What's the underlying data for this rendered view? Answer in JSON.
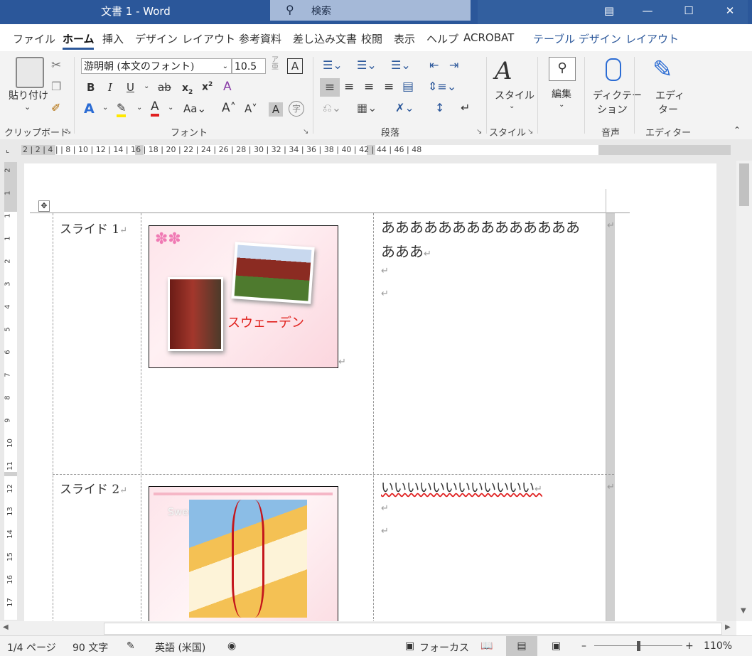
{
  "titlebar": {
    "title": "文書 1  -  Word",
    "search_placeholder": "検索"
  },
  "tabs": [
    {
      "label": "ファイル"
    },
    {
      "label": "ホーム"
    },
    {
      "label": "挿入"
    },
    {
      "label": "デザイン"
    },
    {
      "label": "レイアウト"
    },
    {
      "label": "参考資料"
    },
    {
      "label": "差し込み文書"
    },
    {
      "label": "校閲"
    },
    {
      "label": "表示"
    },
    {
      "label": "ヘルプ"
    },
    {
      "label": "ACROBAT"
    },
    {
      "label": "テーブル デザイン"
    },
    {
      "label": "レイアウト"
    }
  ],
  "ribbon": {
    "clipboard": {
      "paste": "貼り付け",
      "group": "クリップボード"
    },
    "font": {
      "name": "游明朝 (本文のフォント)",
      "size": "10.5",
      "group": "フォント"
    },
    "paragraph": {
      "group": "段落"
    },
    "style": {
      "button": "スタイル",
      "group": "スタイル"
    },
    "edit": {
      "button": "編集"
    },
    "voice": {
      "button_line1": "ディクテー",
      "button_line2": "ション",
      "group": "音声"
    },
    "editor": {
      "button_line1": "エディ",
      "button_line2": "ター",
      "group": "エディター"
    }
  },
  "ruler": {
    "ticks": "2 | 2 | 4 | | 8 | 10 | 12 | 14 | 16 | 18 | 20 | 22 | 24 | 26 | 28 | 30 | 32 | 34 | 36 | 38 | 40 | 42 | 44 | 46 | 48"
  },
  "vruler": {
    "numbers": [
      "2",
      "1",
      "1",
      "1",
      "2",
      "3",
      "4",
      "5",
      "6",
      "7",
      "8",
      "9",
      "10",
      "11",
      "12",
      "13",
      "14",
      "15",
      "16",
      "17"
    ]
  },
  "document": {
    "rows": [
      {
        "label": "スライド 1",
        "slide_caption": "スウェーデン",
        "text_line1": "ああああああああああああああ",
        "text_line2": "あああ"
      },
      {
        "label": "スライド 2",
        "slide_caption": "Sweden MAP",
        "text_line1": "いいいいいいいいいいいい"
      }
    ]
  },
  "statusbar": {
    "page": "1/4 ページ",
    "words": "90 文字",
    "language": "英語 (米国)",
    "focus": "フォーカス",
    "zoom": "110%"
  },
  "colors": {
    "titlebar": "#2b579a",
    "accent": "#2b579a",
    "ribbon_bg": "#f3f3f3",
    "caption_red": "#e0201c"
  }
}
